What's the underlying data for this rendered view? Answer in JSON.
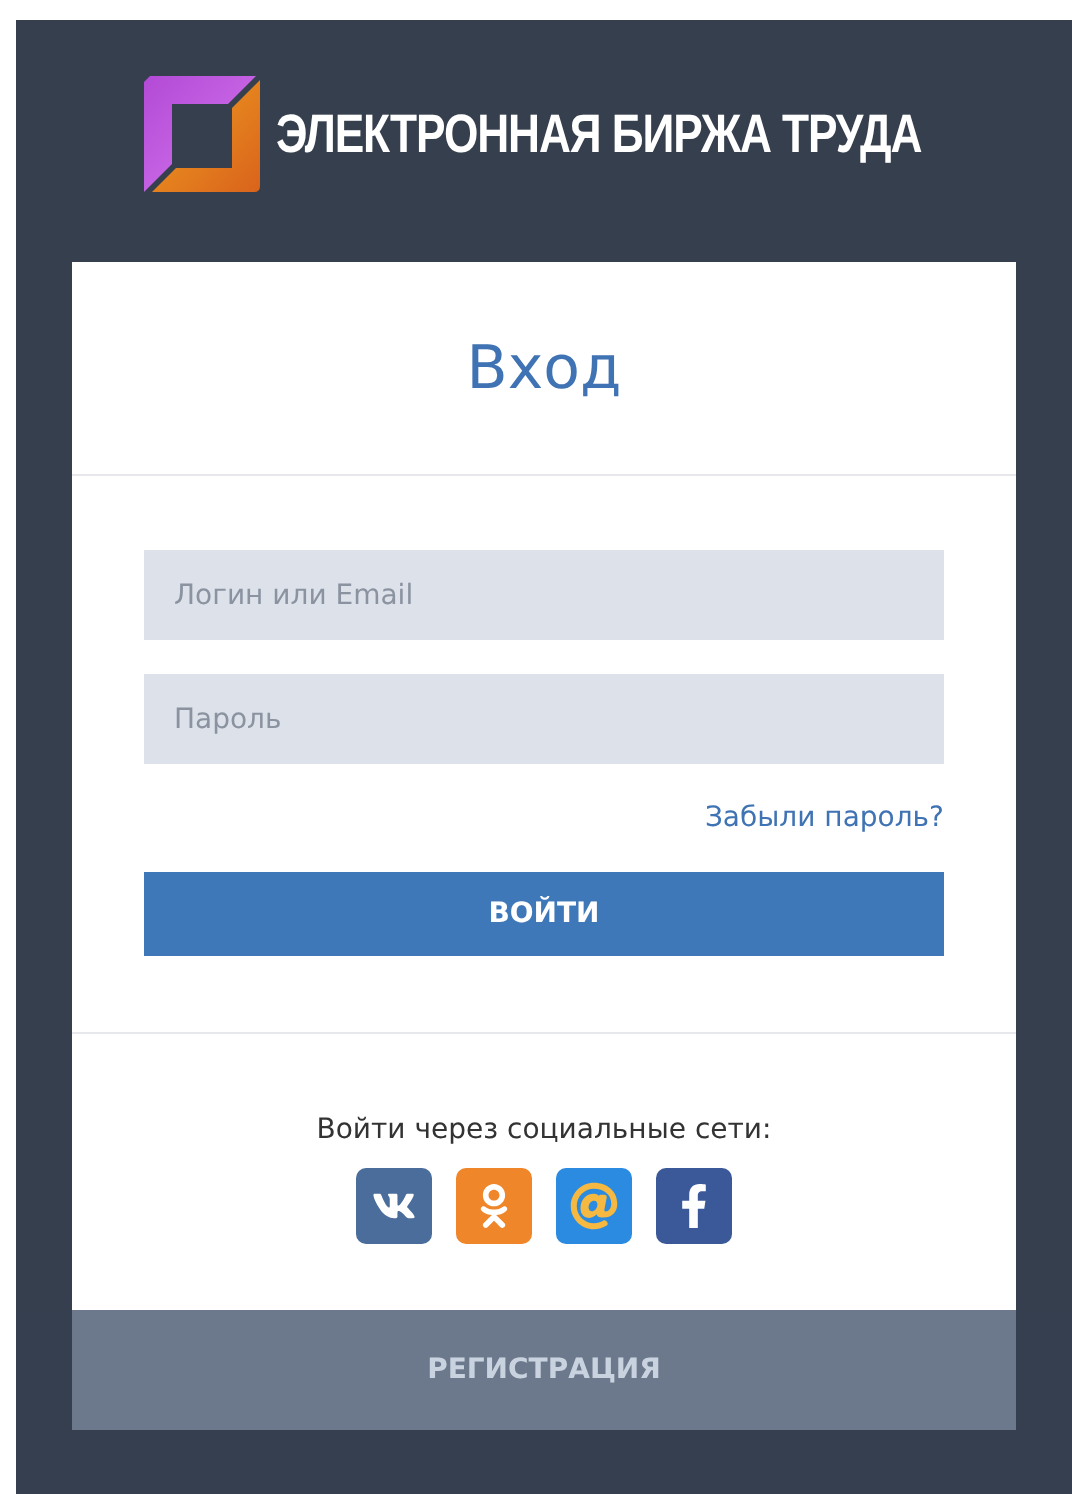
{
  "logo": {
    "text": "ЭЛЕКТРОННАЯ БИРЖА ТРУДА"
  },
  "login": {
    "title": "Вход",
    "login_field": {
      "placeholder": "Логин или Email"
    },
    "password_field": {
      "placeholder": "Пароль"
    },
    "forgot_link": "Забыли пароль?",
    "submit_button": "ВОЙТИ",
    "social_caption": "Войти через социальные сети:",
    "social": [
      {
        "kind": "vk",
        "color": "#4a6d9c"
      },
      {
        "kind": "ok",
        "color": "#f0862a"
      },
      {
        "kind": "mail",
        "color": "#2a8be0"
      },
      {
        "kind": "facebook",
        "color": "#3b5998"
      }
    ],
    "register_button": "РЕГИСТРАЦИЯ"
  }
}
